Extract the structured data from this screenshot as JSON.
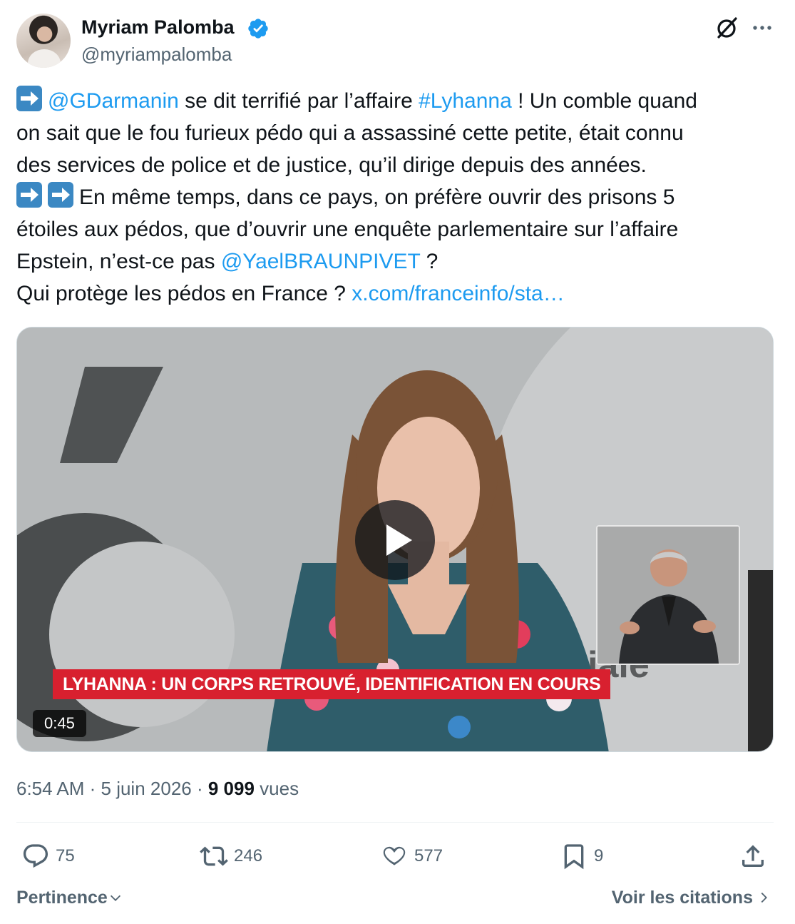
{
  "author": {
    "name": "Myriam Palomba",
    "handle": "@myriampalomba"
  },
  "tweet": {
    "l1_mention": "@GDarmanin",
    "l1_text": " se dit terrifié par l’affaire ",
    "l1_hashtag": "#Lyhanna",
    "l1_tail": " ! Un comble quand",
    "l2": "on sait que le fou furieux pédo qui a assassiné cette petite, était connu",
    "l3": "des services de police et de justice, qu’il dirige depuis des années.",
    "l4": "En même temps, dans ce pays, on préfère ouvrir des prisons 5",
    "l5": "étoiles aux pédos, que d’ouvrir une enquête parlementaire sur l’affaire",
    "l6_text": "Epstein, n’est-ce pas ",
    "l6_mention": "@YaelBRAUNPIVET",
    "l6_tail": " ?",
    "l7_text": "Qui protège les pédos en France ?  ",
    "l7_link": "x.com/franceinfo/sta…"
  },
  "video": {
    "banner": "LYHANNA : UN CORPS RETROUVÉ, IDENTIFICATION EN COURS",
    "duration": "0:45",
    "bg_text": "iale"
  },
  "meta": {
    "time": "6:54 AM",
    "sep1": " · ",
    "date": "5 juin 2026",
    "sep2": " · ",
    "views_count": "9 099",
    "views_label": " vues"
  },
  "actions": {
    "replies": "75",
    "reposts": "246",
    "likes": "577",
    "bookmarks": "9"
  },
  "footer": {
    "sort_label": "Pertinence",
    "quotes_label": "Voir les citations"
  },
  "colors": {
    "link": "#1d9bf0",
    "secondary": "#536471",
    "banner": "#d8202f"
  }
}
